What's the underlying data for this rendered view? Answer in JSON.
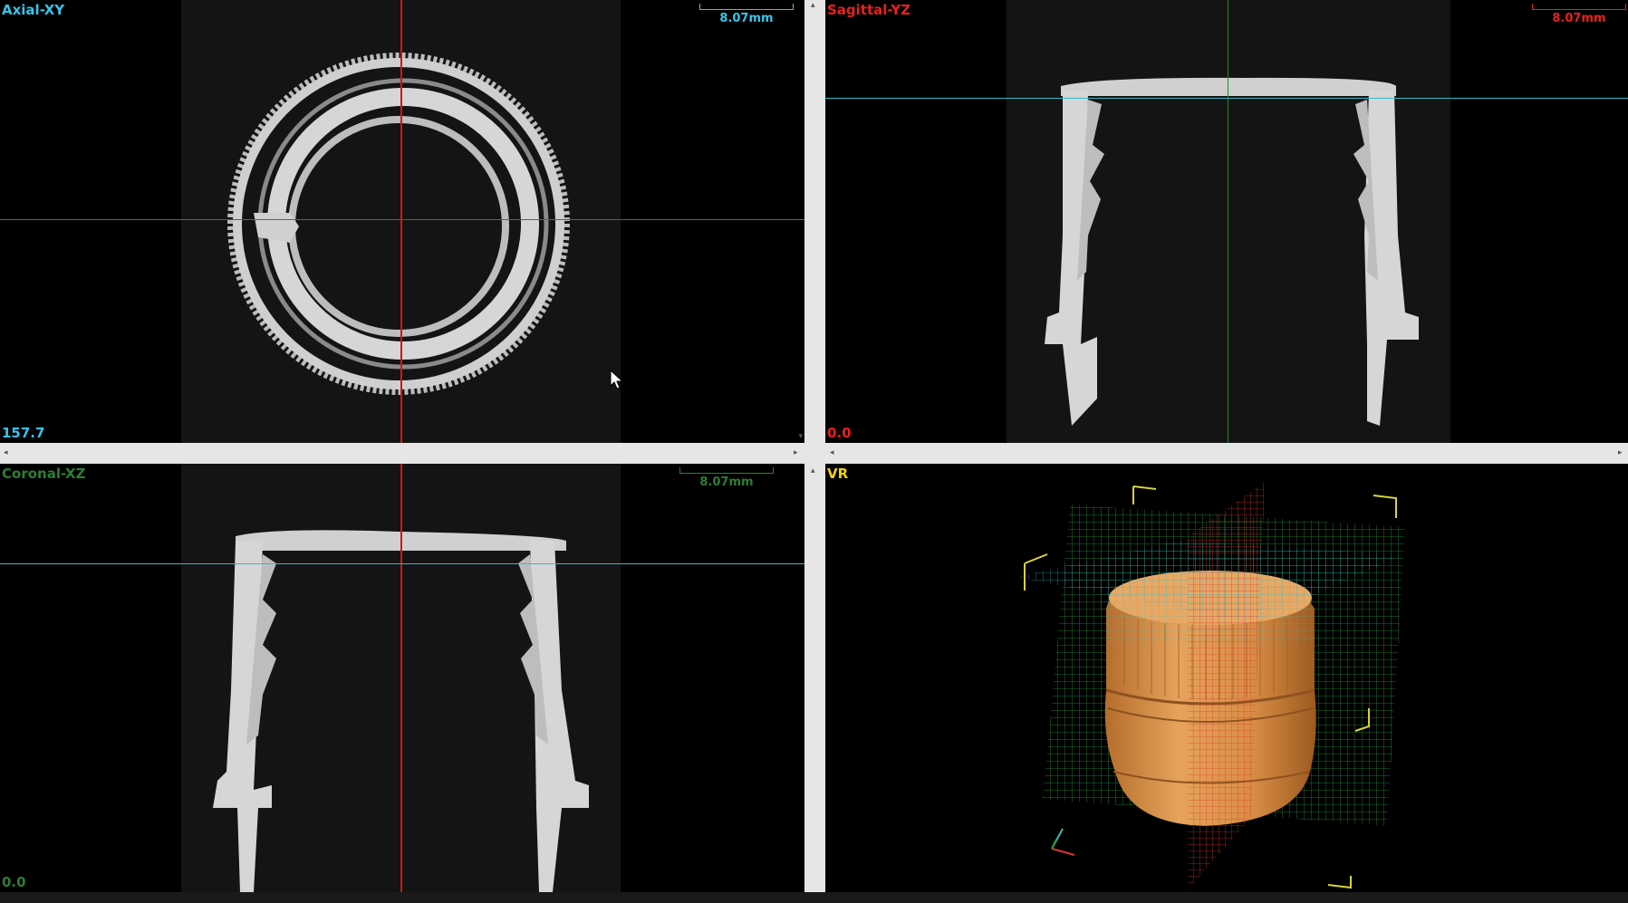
{
  "viewports": {
    "axial": {
      "label": "Axial-XY",
      "scale": "8.07mm",
      "readout": "157.7",
      "color": "#37c4e8"
    },
    "sagittal": {
      "label": "Sagittal-YZ",
      "scale": "8.07mm",
      "readout": "0.0",
      "color": "#e8201e"
    },
    "coronal": {
      "label": "Coronal-XZ",
      "scale": "8.07mm",
      "readout": "0.0",
      "color": "#2e7d32"
    },
    "vr": {
      "label": "VR",
      "color": "#f2d600"
    }
  },
  "colors": {
    "crosshair_red": "#cc1a14",
    "crosshair_green": "#1e8a2a",
    "crosshair_cyan": "#36b8c8",
    "splitter": "#e6e6e6",
    "object": "#d9914a",
    "slice_gray": "#d8d8d8"
  },
  "icons": [
    "mouse-cursor-icon",
    "scroll-left-arrow-icon",
    "scroll-right-arrow-icon",
    "scroll-up-arrow-icon",
    "scroll-down-arrow-icon",
    "axis-triad-icon"
  ]
}
